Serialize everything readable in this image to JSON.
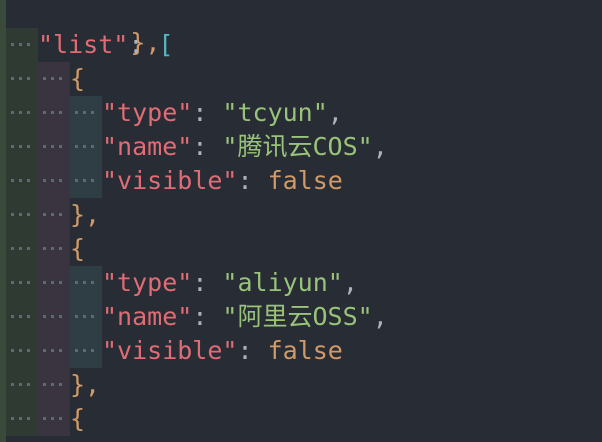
{
  "editor": {
    "lines": [
      {
        "kind": "close",
        "text": "},"
      },
      {
        "kind": "list_open",
        "key": "\"list\"",
        "colon": ": ",
        "bracket": "["
      },
      {
        "kind": "brace",
        "text": "{"
      },
      {
        "kind": "prop",
        "key": "\"type\"",
        "colon": ": ",
        "value": "\"tcyun\"",
        "comma": ","
      },
      {
        "kind": "prop",
        "key": "\"name\"",
        "colon": ": ",
        "value": "\"腾讯云COS\"",
        "comma": ","
      },
      {
        "kind": "prop_bool",
        "key": "\"visible\"",
        "colon": ": ",
        "value": "false",
        "comma": ""
      },
      {
        "kind": "brace",
        "text": "},"
      },
      {
        "kind": "brace",
        "text": "{"
      },
      {
        "kind": "prop",
        "key": "\"type\"",
        "colon": ": ",
        "value": "\"aliyun\"",
        "comma": ","
      },
      {
        "kind": "prop",
        "key": "\"name\"",
        "colon": ": ",
        "value": "\"阿里云OSS\"",
        "comma": ","
      },
      {
        "kind": "prop_bool",
        "key": "\"visible\"",
        "colon": ": ",
        "value": "false",
        "comma": ""
      },
      {
        "kind": "brace",
        "text": "},"
      },
      {
        "kind": "brace",
        "text": "{"
      }
    ]
  },
  "colors": {
    "background": "#282c34",
    "key": "#e06c75",
    "string": "#98c379",
    "boolean": "#d19a66",
    "bracket": "#56b6c2"
  }
}
